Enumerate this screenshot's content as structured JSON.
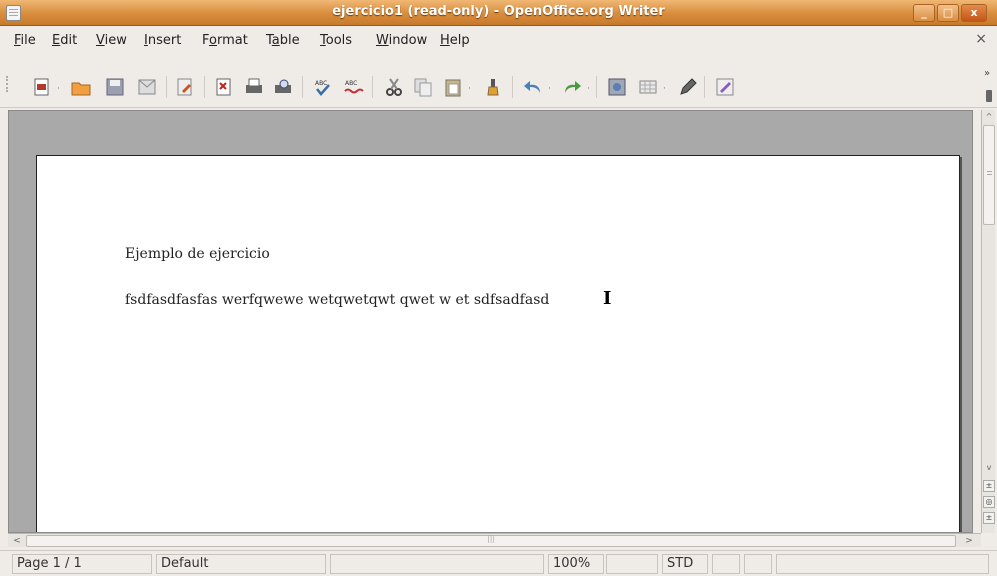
{
  "window": {
    "title": "ejercicio1 (read-only) - OpenOffice.org Writer",
    "buttons": [
      "_",
      "□",
      "x"
    ]
  },
  "menu": {
    "items": [
      {
        "mnemonic": "F",
        "rest": "ile"
      },
      {
        "mnemonic": "E",
        "rest": "dit",
        "pre": ""
      },
      {
        "mnemonic": "V",
        "rest": "iew"
      },
      {
        "mnemonic": "I",
        "rest": "nsert"
      },
      {
        "pre": "F",
        "mnemonic": "o",
        "rest": "rmat"
      },
      {
        "pre": "T",
        "mnemonic": "a",
        "rest": "ble"
      },
      {
        "mnemonic": "T",
        "rest": "ools"
      },
      {
        "mnemonic": "W",
        "rest": "indow"
      },
      {
        "mnemonic": "H",
        "rest": "elp"
      }
    ],
    "close_doc": "×"
  },
  "toolbar": {
    "overflow": "»",
    "icons": [
      "new-document-icon",
      "open-icon",
      "save-icon",
      "email-icon",
      "edit-file-icon",
      "export-pdf-icon",
      "print-icon",
      "print-preview-icon",
      "spellcheck-icon",
      "autospellcheck-icon",
      "cut-icon",
      "copy-icon",
      "paste-icon",
      "clone-formatting-icon",
      "undo-icon",
      "redo-icon",
      "navigator-icon",
      "table-icon",
      "show-draw-functions-icon",
      "gallery-icon"
    ],
    "drop_glyph": "·"
  },
  "document": {
    "paragraphs": [
      "Ejemplo de ejercicio",
      "fsdfasdfasfas werfqwewe wetqwetqwt qwet w et sdfsadfasd"
    ],
    "cursor_glyph": "I"
  },
  "scrollbar": {
    "up": "^",
    "down": "v",
    "left": "<",
    "right": ">",
    "nav": [
      "±",
      "◎",
      "±"
    ]
  },
  "status": {
    "page": "Page 1 / 1",
    "style": "Default",
    "zoom": "100%",
    "mode": "STD"
  },
  "colors": {
    "titlebar": "#d88c3c",
    "canvas": "#a9a9a9",
    "page": "#ffffff"
  }
}
